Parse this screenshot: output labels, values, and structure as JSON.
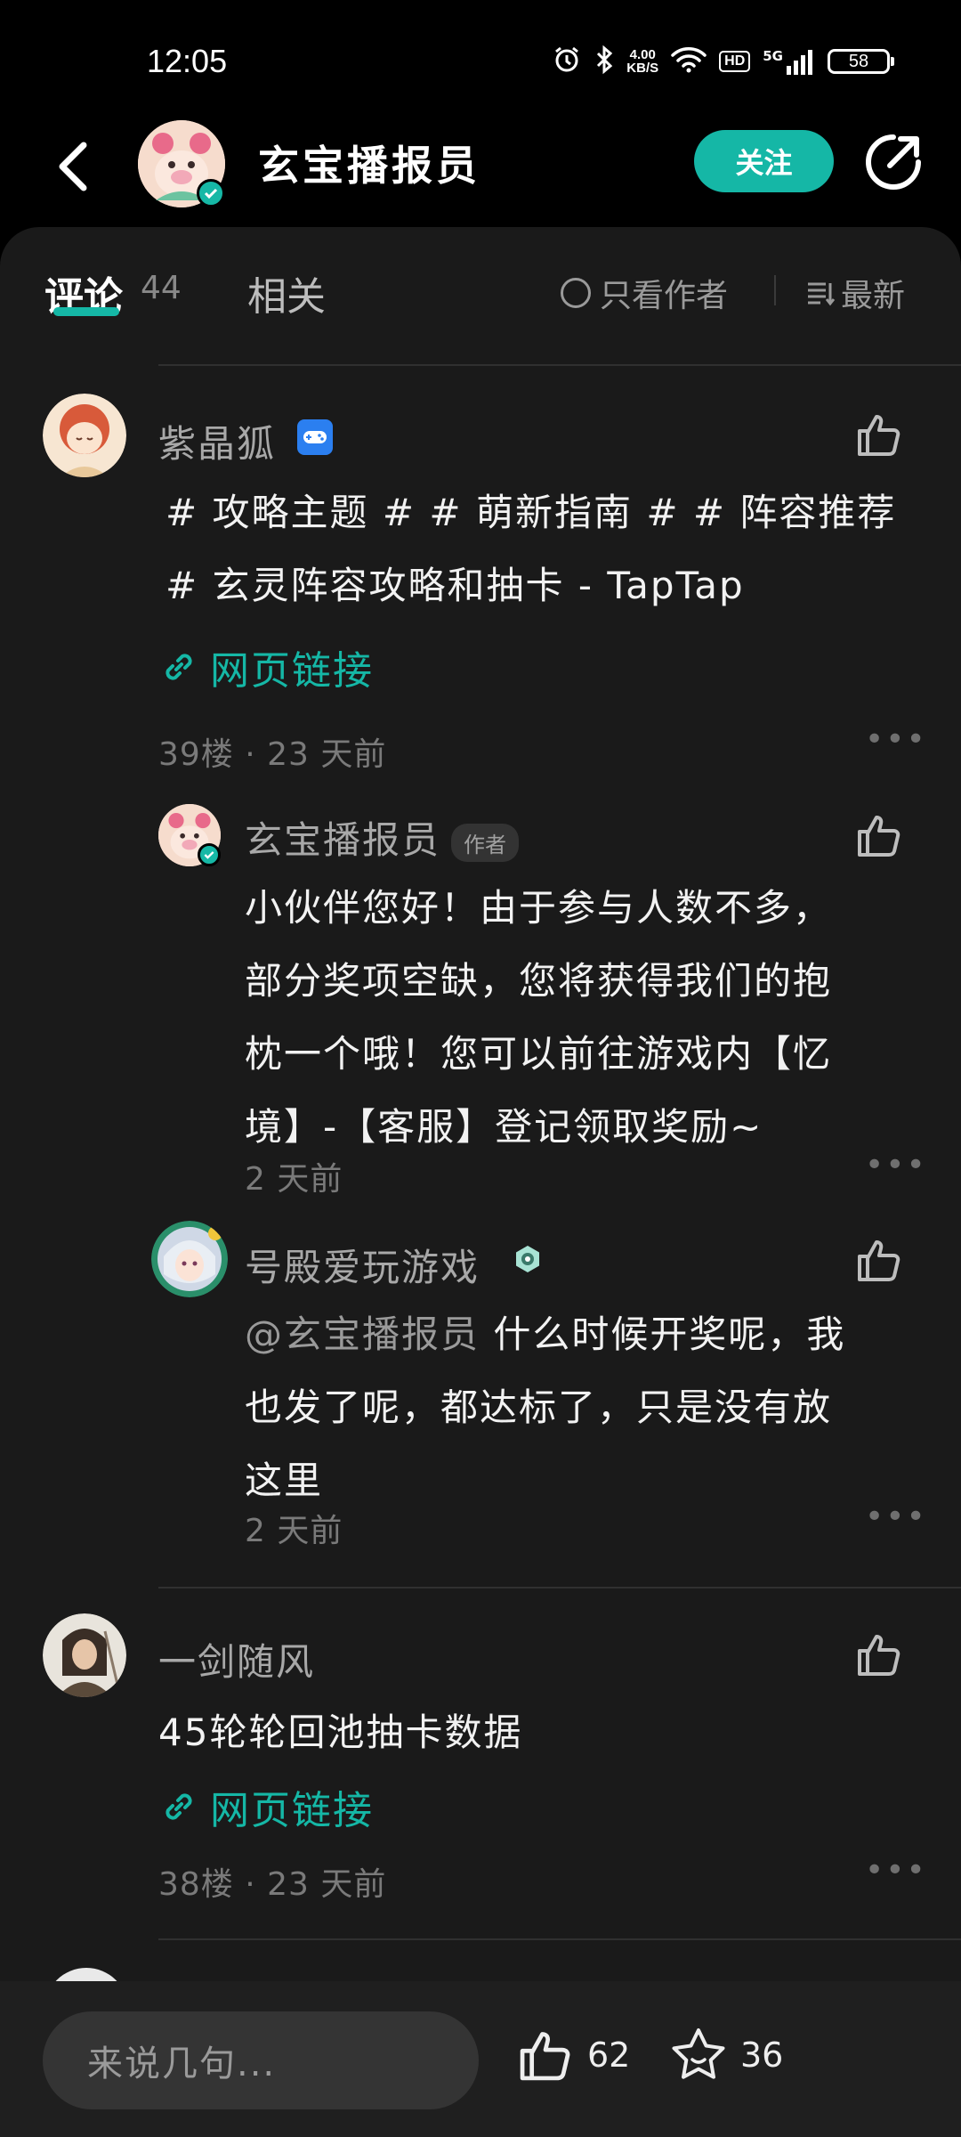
{
  "status_bar": {
    "time": "12:05",
    "net_speed_value": "4.00",
    "net_speed_unit": "KB/S",
    "hd": "HD",
    "network": "5G",
    "battery": "58"
  },
  "header": {
    "title": "玄宝播报员",
    "follow_label": "关注"
  },
  "tabs": {
    "comments_label": "评论",
    "comments_count": "44",
    "related_label": "相关",
    "only_author_label": "只看作者",
    "sort_label": "最新"
  },
  "comments": [
    {
      "username": "紫晶狐",
      "lines": [
        "# 攻略主题 # # 萌新指南 # # 阵容推荐",
        "# 玄灵阵容攻略和抽卡 - TapTap"
      ],
      "link_label": "网页链接",
      "meta": "39楼 · 23 天前",
      "replies": [
        {
          "username": "玄宝播报员",
          "author_tag": "作者",
          "lines": [
            "小伙伴您好！由于参与人数不多，",
            "部分奖项空缺，您将获得我们的抱",
            "枕一个哦！您可以前往游戏内【忆",
            "境】-【客服】登记领取奖励~"
          ],
          "meta": "2 天前"
        },
        {
          "username": "号殿爱玩游戏",
          "mention": "@玄宝播报员",
          "first_line_rest": " 什么时候开奖呢，我",
          "lines": [
            "也发了呢，都达标了，只是没有放",
            "这里"
          ],
          "meta": "2 天前"
        }
      ]
    },
    {
      "username": "一剑随风",
      "lines": [
        "45轮轮回池抽卡数据"
      ],
      "link_label": "网页链接",
      "meta": "38楼 · 23 天前"
    }
  ],
  "bottom_bar": {
    "input_placeholder": "来说几句...",
    "like_count": "62",
    "fav_count": "36"
  },
  "colors": {
    "accent": "#15b7a6",
    "panel_bg": "#1a1a1a"
  }
}
